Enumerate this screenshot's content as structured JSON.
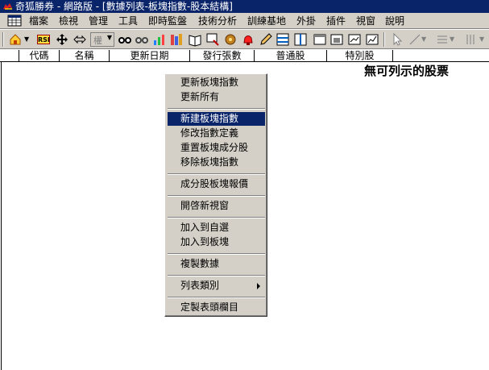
{
  "window": {
    "title": "奇狐勝券 - 網路版 - [數據列表-板塊指數-股本結構]"
  },
  "menu": [
    "檔案",
    "檢視",
    "管理",
    "工具",
    "即時監盤",
    "技術分析",
    "訓練基地",
    "外掛",
    "插件",
    "視窗",
    "說明"
  ],
  "toolbar": {
    "rsi_label": "RSI",
    "combo_value": "權",
    "icons": [
      "home-icon",
      "rsi-icon",
      "move-icon",
      "resize-icon",
      "weight-combo",
      "glasses-icon",
      "glasses2-icon",
      "chart-icon",
      "books-icon",
      "book-icon",
      "monitor-icon",
      "gear-icon",
      "alarm-icon",
      "pencil-icon",
      "rows-icon",
      "columns-icon",
      "window1-icon",
      "window2-icon",
      "window3-icon",
      "window4-icon",
      "cursor-icon",
      "line-icon",
      "list-icon",
      "bars-icon"
    ]
  },
  "table": {
    "columns": [
      "代碼",
      "名稱",
      "更新日期",
      "發行張數",
      "普通股",
      "特別股"
    ],
    "empty_message": "無可列示的股票"
  },
  "context_menu": {
    "groups": [
      [
        "更新板塊指數",
        "更新所有"
      ],
      [
        "新建板塊指數",
        "修改指數定義",
        "重置板塊成分股",
        "移除板塊指數"
      ],
      [
        "成分股板塊報價"
      ],
      [
        "開啓新視窗"
      ],
      [
        "加入到自選",
        "加入到板塊"
      ],
      [
        "複製數據"
      ],
      [
        "列表類別"
      ],
      [
        "定製表頭欄目"
      ]
    ],
    "highlighted": "新建板塊指數"
  },
  "colors": {
    "titlebar": "#0a246a",
    "highlight": "#0a246a",
    "chrome": "#d4d0c8"
  }
}
